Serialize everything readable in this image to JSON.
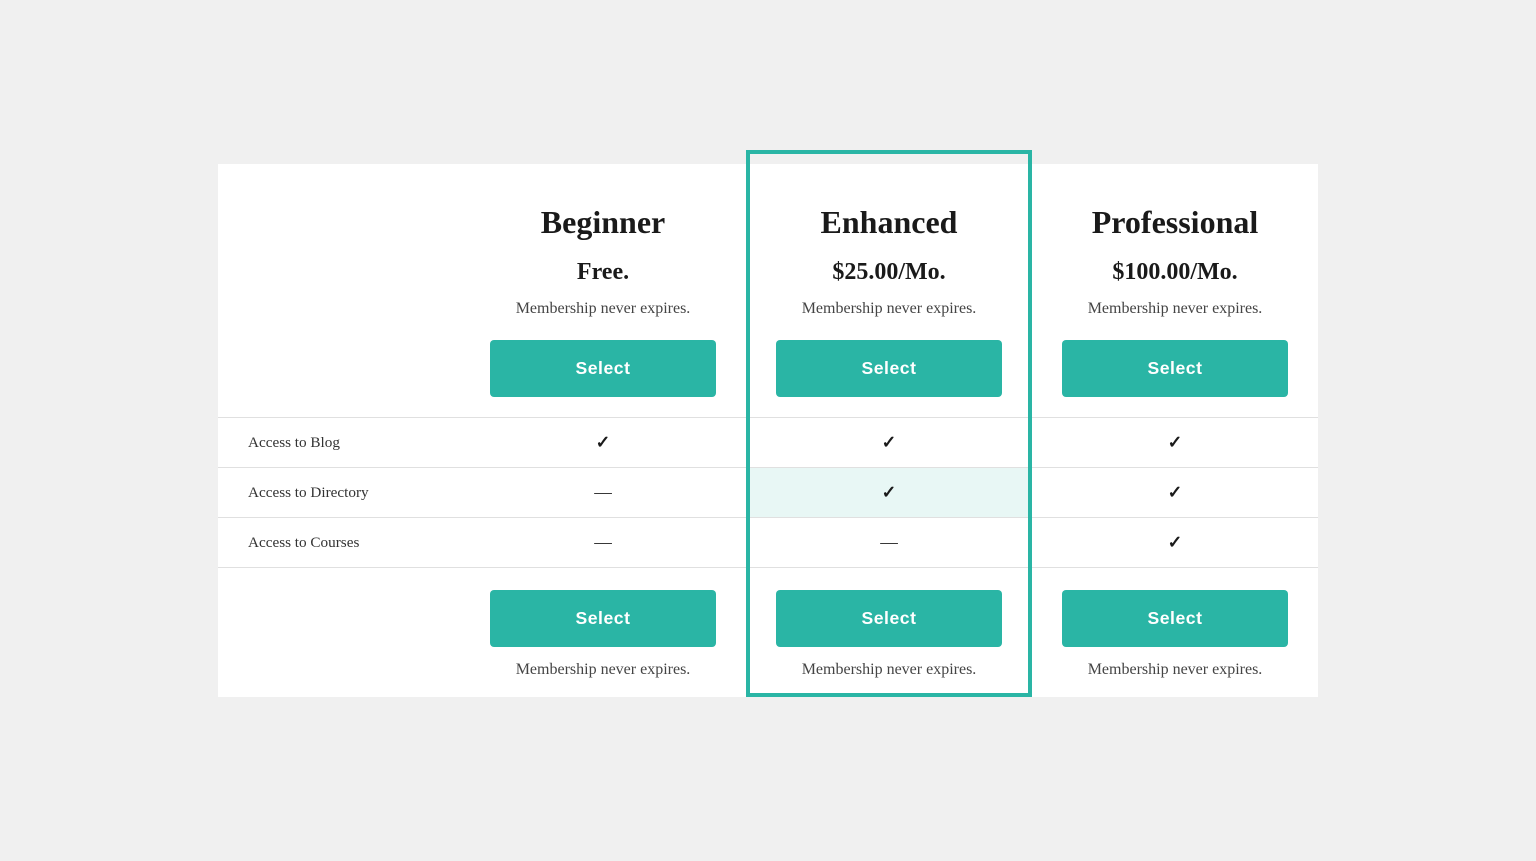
{
  "plans": [
    {
      "id": "beginner",
      "name": "Beginner",
      "price": "Free.",
      "note": "Membership never expires.",
      "select_label": "Select",
      "featured": false
    },
    {
      "id": "enhanced",
      "name": "Enhanced",
      "price": "$25.00/Mo.",
      "note": "Membership never expires.",
      "select_label": "Select",
      "featured": true
    },
    {
      "id": "professional",
      "name": "Professional",
      "price": "$100.00/Mo.",
      "note": "Membership never expires.",
      "select_label": "Select",
      "featured": false
    }
  ],
  "features": [
    {
      "label": "Access to Blog",
      "beginner": "check",
      "enhanced": "check",
      "professional": "check",
      "alt": false
    },
    {
      "label": "Access to Directory",
      "beginner": "dash",
      "enhanced": "check",
      "professional": "check",
      "alt": true
    },
    {
      "label": "Access to Courses",
      "beginner": "dash",
      "enhanced": "dash",
      "professional": "check",
      "alt": true
    }
  ],
  "bottom_notes": {
    "beginner": "Membership never expires.",
    "enhanced": "Membership never expires.",
    "professional": "Membership never expires."
  },
  "select_label": "Select",
  "colors": {
    "accent": "#2ab5a5",
    "featured_border": "#2ab5a5",
    "btn_text": "#ffffff"
  }
}
